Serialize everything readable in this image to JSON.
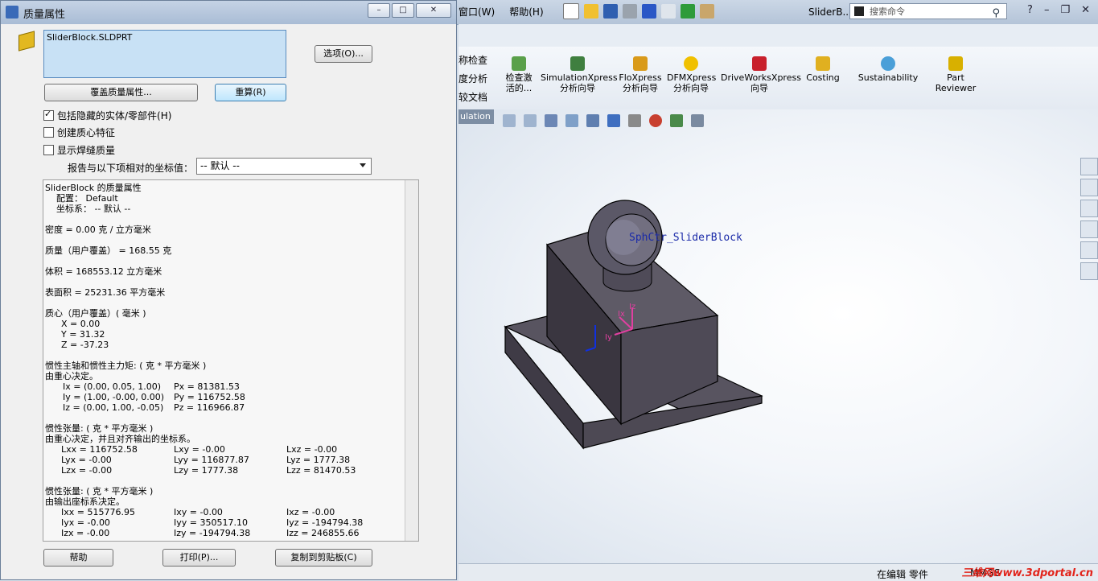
{
  "app": {
    "menu": [
      "窗口(W)",
      "帮助(H)"
    ],
    "doc_title": "SliderB...",
    "search_placeholder": "搜索命令",
    "tab_label": "ulation",
    "command_manager": {
      "side_items": [
        "称检查",
        "度分析",
        "较文档"
      ],
      "items": [
        {
          "line1": "检查激",
          "line2": "活的..."
        },
        {
          "line1": "SimulationXpress",
          "line2": "分析向导"
        },
        {
          "line1": "FloXpress",
          "line2": "分析向导"
        },
        {
          "line1": "DFMXpress",
          "line2": "分析向导"
        },
        {
          "line1": "DriveWorksXpress",
          "line2": "向导"
        },
        {
          "line1": "Costing",
          "line2": ""
        },
        {
          "line1": "Sustainability",
          "line2": ""
        },
        {
          "line1": "Part",
          "line2": "Reviewer"
        }
      ]
    },
    "viewport": {
      "sketch_label": "SphCtr_SliderBlock",
      "axis_x": "Ix",
      "axis_y": "Iy",
      "axis_z": "Iz"
    },
    "status": {
      "edit_mode": "在编辑 零件",
      "units": "MMGS"
    },
    "watermark": "三维网www.3dportal.cn"
  },
  "dialog": {
    "title": "质量属性",
    "selection": "SliderBlock.SLDPRT",
    "options_button": "选项(O)...",
    "override_button": "覆盖质量属性...",
    "recalc_button": "重算(R)",
    "checkboxes": [
      {
        "label": "包括隐藏的实体/零部件(H)",
        "checked": true
      },
      {
        "label": "创建质心特征",
        "checked": false
      },
      {
        "label": "显示焊缝质量",
        "checked": false
      }
    ],
    "coord_label": "报告与以下项相对的坐标值：",
    "coord_value": "-- 默认 --",
    "results": {
      "title": "SliderBlock 的质量属性",
      "config": "配置： Default",
      "coordsys": "坐标系： -- 默认 --",
      "density": "密度 = 0.00 克 / 立方毫米",
      "mass": "质量（用户覆盖） = 168.55 克",
      "volume": "体积 = 168553.12 立方毫米",
      "surface": "表面积 = 25231.36  平方毫米",
      "com_title": "质心（用户覆盖）( 毫米 )",
      "com_x": "X = 0.00",
      "com_y": "Y = 31.32",
      "com_z": "Z = -37.23",
      "principal_title": "惯性主轴和惯性主力矩: ( 克 *  平方毫米 )",
      "principal_sub": "由重心决定。",
      "ix": "Ix = (0.00, 0.05, 1.00)",
      "iy": "Iy = (1.00, -0.00, 0.00)",
      "iz": "Iz = (0.00, 1.00, -0.05)",
      "px": "Px = 81381.53",
      "py": "Py = 116752.58",
      "pz": "Pz = 116966.87",
      "tensor1_title": "惯性张量: ( 克 *  平方毫米 )",
      "tensor1_sub": "由重心决定，并且对齐输出的坐标系。",
      "t1": [
        [
          "Lxx = 116752.58",
          "Lxy = -0.00",
          "Lxz = -0.00"
        ],
        [
          "Lyx = -0.00",
          "Lyy = 116877.87",
          "Lyz = 1777.38"
        ],
        [
          "Lzx = -0.00",
          "Lzy = 1777.38",
          "Lzz = 81470.53"
        ]
      ],
      "tensor2_title": "惯性张量: ( 克 *  平方毫米 )",
      "tensor2_sub": "由输出座标系决定。",
      "t2": [
        [
          "Ixx = 515776.95",
          "Ixy = -0.00",
          "Ixz = -0.00"
        ],
        [
          "Iyx = -0.00",
          "Iyy = 350517.10",
          "Iyz = -194794.38"
        ],
        [
          "Izx = -0.00",
          "Izy = -194794.38",
          "Izz = 246855.66"
        ]
      ]
    },
    "help_button": "帮助",
    "print_button": "打印(P)...",
    "copy_button": "复制到剪贴板(C)"
  }
}
